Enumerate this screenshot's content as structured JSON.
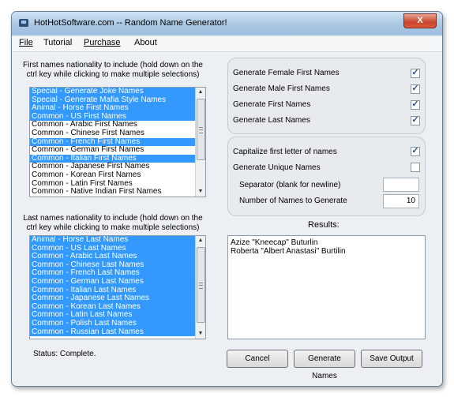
{
  "window": {
    "title": "HotHotSoftware.com -- Random Name Generator!",
    "close_glyph": "X"
  },
  "menu": [
    "File",
    "Tutorial",
    "Purchase",
    "About"
  ],
  "first_names": {
    "label": "First names nationality to include (hold down on the ctrl key while clicking to make multiple selections)",
    "items": [
      {
        "text": "Special - Generate Joke Names",
        "selected": true
      },
      {
        "text": "Special - Generate Mafia Style Names",
        "selected": true
      },
      {
        "text": "Animal - Horse First Names",
        "selected": true
      },
      {
        "text": "Common - US First Names",
        "selected": true
      },
      {
        "text": "Common - Arabic First Names",
        "selected": false
      },
      {
        "text": "Common - Chinese First Names",
        "selected": false
      },
      {
        "text": "Common - French First Names",
        "selected": true
      },
      {
        "text": "Common - German First Names",
        "selected": false
      },
      {
        "text": "Common - Italian First Names",
        "selected": true
      },
      {
        "text": "Common - Japanese First Names",
        "selected": false
      },
      {
        "text": "Common - Korean First Names",
        "selected": false
      },
      {
        "text": "Common - Latin First Names",
        "selected": false
      },
      {
        "text": "Common - Native Indian First Names",
        "selected": false
      }
    ]
  },
  "last_names": {
    "label": "Last names nationality to include (hold down on the ctrl key while clicking to make multiple selections)",
    "items": [
      {
        "text": "Animal - Horse Last Names",
        "selected": true
      },
      {
        "text": "Common - US Last Names",
        "selected": true
      },
      {
        "text": "Common - Arabic Last Names",
        "selected": true
      },
      {
        "text": "Common - Chinese Last Names",
        "selected": true
      },
      {
        "text": "Common - French Last Names",
        "selected": true
      },
      {
        "text": "Common - German Last Names",
        "selected": true
      },
      {
        "text": "Common - Italian Last Names",
        "selected": true
      },
      {
        "text": "Common - Japanese Last Names",
        "selected": true
      },
      {
        "text": "Common - Korean Last Names",
        "selected": true
      },
      {
        "text": "Common - Latin Last Names",
        "selected": true
      },
      {
        "text": "Common - Polish Last Names",
        "selected": true
      },
      {
        "text": "Common - Russian Last Names",
        "selected": true
      }
    ]
  },
  "options": {
    "generate_female": {
      "label": "Generate Female First Names",
      "checked": true
    },
    "generate_male": {
      "label": "Generate Male First Names",
      "checked": true
    },
    "generate_first": {
      "label": "Generate First Names",
      "checked": true
    },
    "generate_last": {
      "label": "Generate Last Names",
      "checked": true
    },
    "capitalize": {
      "label": "Capitalize first letter of names",
      "checked": true
    },
    "unique": {
      "label": "Generate Unique Names",
      "checked": false
    },
    "separator": {
      "label": "Separator (blank for newline)",
      "value": ""
    },
    "count": {
      "label": "Number of Names to Generate",
      "value": "10"
    }
  },
  "results": {
    "label": "Results:",
    "lines": [
      "Azize \"Kneecap\" Buturlin",
      "Roberta \"Albert Anastasi\" Burtilin"
    ]
  },
  "status": "Status: Complete.",
  "buttons": {
    "cancel": "Cancel",
    "generate": "Generate Names",
    "save": "Save Output"
  },
  "check_glyph": "✓",
  "scroll_up": "▲",
  "scroll_down": "▼"
}
